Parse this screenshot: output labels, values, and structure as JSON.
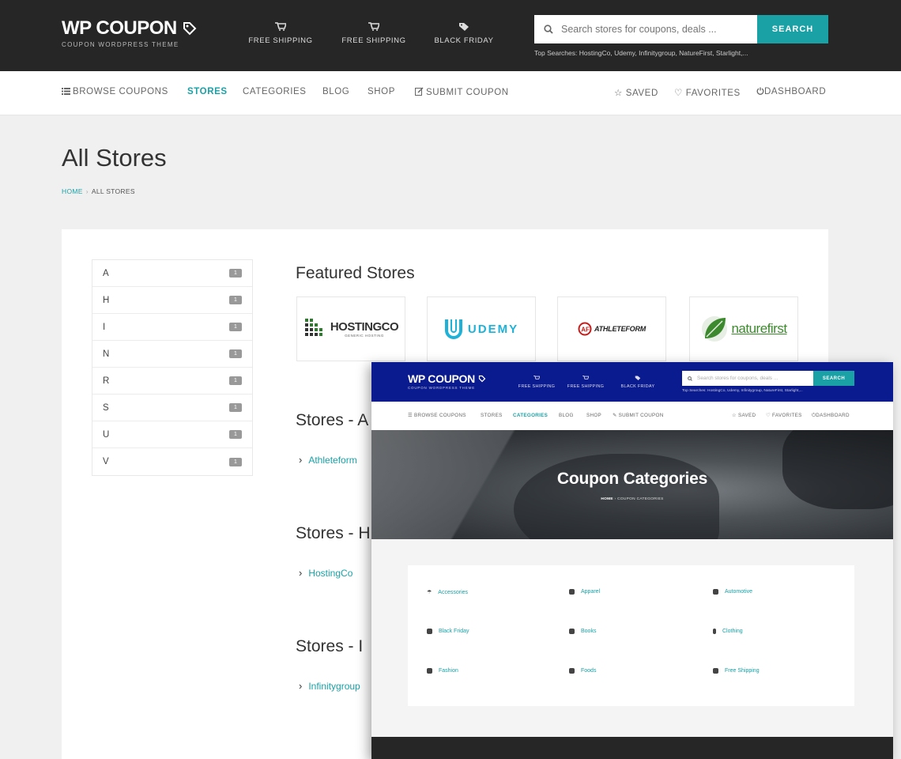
{
  "header": {
    "logo_title": "WP COUPON",
    "logo_subtitle": "COUPON WORDPRESS THEME",
    "quick_links": [
      {
        "label": "FREE SHIPPING",
        "icon": "cart-icon"
      },
      {
        "label": "FREE SHIPPING",
        "icon": "cart-icon"
      },
      {
        "label": "BLACK FRIDAY",
        "icon": "tag-icon"
      }
    ],
    "search_placeholder": "Search stores for coupons, deals ...",
    "search_button": "SEARCH",
    "top_searches_label": "Top Searches:",
    "top_searches": "HostingCo, Udemy, Infinitygroup, NatureFirst, Starlight,..."
  },
  "nav": {
    "browse": "BROWSE COUPONS",
    "stores": "STORES",
    "categories": "CATEGORIES",
    "blog": "BLOG",
    "shop": "SHOP",
    "submit": "SUBMIT COUPON",
    "saved": "SAVED",
    "favorites": "FAVORITES",
    "dashboard": "DASHBOARD",
    "active": "STORES"
  },
  "page": {
    "title": "All Stores",
    "breadcrumb_home": "HOME",
    "breadcrumb_sep": "›",
    "breadcrumb_current": "ALL STORES"
  },
  "letters": [
    {
      "letter": "A",
      "count": "1"
    },
    {
      "letter": "H",
      "count": "1"
    },
    {
      "letter": "I",
      "count": "1"
    },
    {
      "letter": "N",
      "count": "1"
    },
    {
      "letter": "R",
      "count": "1"
    },
    {
      "letter": "S",
      "count": "1"
    },
    {
      "letter": "U",
      "count": "1"
    },
    {
      "letter": "V",
      "count": "1"
    }
  ],
  "featured": {
    "title": "Featured Stores",
    "stores": [
      "HOSTINGCO",
      "UDEMY",
      "ATHLETEFORM",
      "naturefirst"
    ],
    "hosting_tagline": "GENERIC HOSTING"
  },
  "sections": [
    {
      "title": "Stores - A",
      "link": "Athleteform"
    },
    {
      "title": "Stores - H",
      "link": "HostingCo"
    },
    {
      "title": "Stores - I",
      "link": "Infinitygroup"
    }
  ],
  "overlay": {
    "logo_title": "WP COUPON",
    "logo_subtitle": "COUPON WORDPRESS THEME",
    "quick_links": [
      "FREE SHIPPING",
      "FREE SHIPPING",
      "BLACK FRIDAY"
    ],
    "search_placeholder": "Search stores for coupons, deals ...",
    "search_button": "SEARCH",
    "top_searches": "Top Searches: HostingCo, Udemy, Infinitygroup, NatureFirst, Starlight,...",
    "nav": {
      "browse": "BROWSE COUPONS",
      "stores": "STORES",
      "categories": "CATEGORIES",
      "blog": "BLOG",
      "shop": "SHOP",
      "submit": "SUBMIT COUPON",
      "saved": "SAVED",
      "favorites": "FAVORITES",
      "dashboard": "DASHBOARD"
    },
    "hero_title": "Coupon Categories",
    "hero_crumb_home": "HOME",
    "hero_crumb_current": "COUPON CATEGORIES",
    "categories": [
      "Accessories",
      "Apparel",
      "Automotive",
      "Black Friday",
      "Books",
      "Clothing",
      "Fashion",
      "Foods",
      "Free Shipping"
    ]
  },
  "colors": {
    "accent": "#1aa1a6",
    "header_bg": "#262626",
    "overlay_header_bg": "#0a1a8f"
  }
}
